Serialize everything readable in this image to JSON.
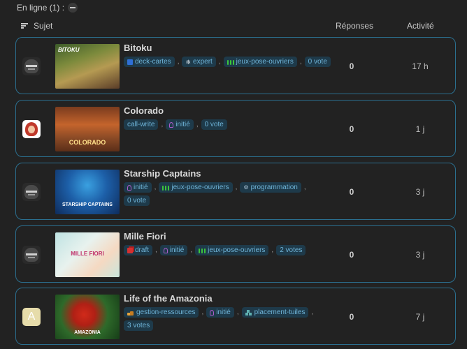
{
  "online": {
    "label": "En ligne (1) :"
  },
  "header": {
    "subject": "Sujet",
    "replies": "Réponses",
    "activity": "Activité"
  },
  "topics": [
    {
      "title": "Bitoku",
      "thumb_title": "BITOKU",
      "avatar": "knight-avatar",
      "tags": [
        {
          "icon": "blue-square-icon",
          "label": "deck-cartes"
        },
        {
          "icon": "snowflake-icon",
          "label": "expert"
        },
        {
          "icon": "meeples-icon",
          "label": "jeux-pose-ouvriers"
        },
        {
          "icon": "",
          "label": "0 vote"
        }
      ],
      "replies": "0",
      "activity": "17 h"
    },
    {
      "title": "Colorado",
      "thumb_title": "COLORADO",
      "avatar": "red-hair-avatar",
      "tags": [
        {
          "icon": "",
          "label": "call-write"
        },
        {
          "icon": "purple-meeple-icon",
          "label": "initié"
        },
        {
          "icon": "",
          "label": "0 vote"
        }
      ],
      "replies": "0",
      "activity": "1 j"
    },
    {
      "title": "Starship Captains",
      "thumb_title": "STARSHIP CAPTAINS",
      "avatar": "knight-avatar",
      "tags": [
        {
          "icon": "purple-meeple-icon",
          "label": "initié"
        },
        {
          "icon": "meeples-icon",
          "label": "jeux-pose-ouvriers"
        },
        {
          "icon": "gears-icon",
          "label": "programmation"
        },
        {
          "icon": "",
          "label": "0 vote"
        }
      ],
      "replies": "0",
      "activity": "3 j"
    },
    {
      "title": "Mille Fiori",
      "thumb_title": "MILLE FIORI",
      "avatar": "knight-avatar",
      "tags": [
        {
          "icon": "red-cards-icon",
          "label": "draft"
        },
        {
          "icon": "purple-meeple-icon",
          "label": "initié"
        },
        {
          "icon": "meeples-icon",
          "label": "jeux-pose-ouvriers"
        },
        {
          "icon": "",
          "label": "2 votes"
        }
      ],
      "replies": "0",
      "activity": "3 j"
    },
    {
      "title": "Life of the Amazonia",
      "thumb_title": "AMAZONIA",
      "avatar": "letter-avatar",
      "avatar_letter": "A",
      "tags": [
        {
          "icon": "resources-icon",
          "label": "gestion-ressources"
        },
        {
          "icon": "purple-meeple-icon",
          "label": "initié"
        },
        {
          "icon": "tiles-icon",
          "label": "placement-tuiles"
        },
        {
          "icon": "",
          "label": "3 votes"
        }
      ],
      "replies": "0",
      "activity": "7 j"
    }
  ],
  "colors": {
    "accent_border": "#2b6f8f",
    "tag_bg": "#1e3a4a",
    "tag_text": "#6fb4d8",
    "background": "#222222"
  }
}
